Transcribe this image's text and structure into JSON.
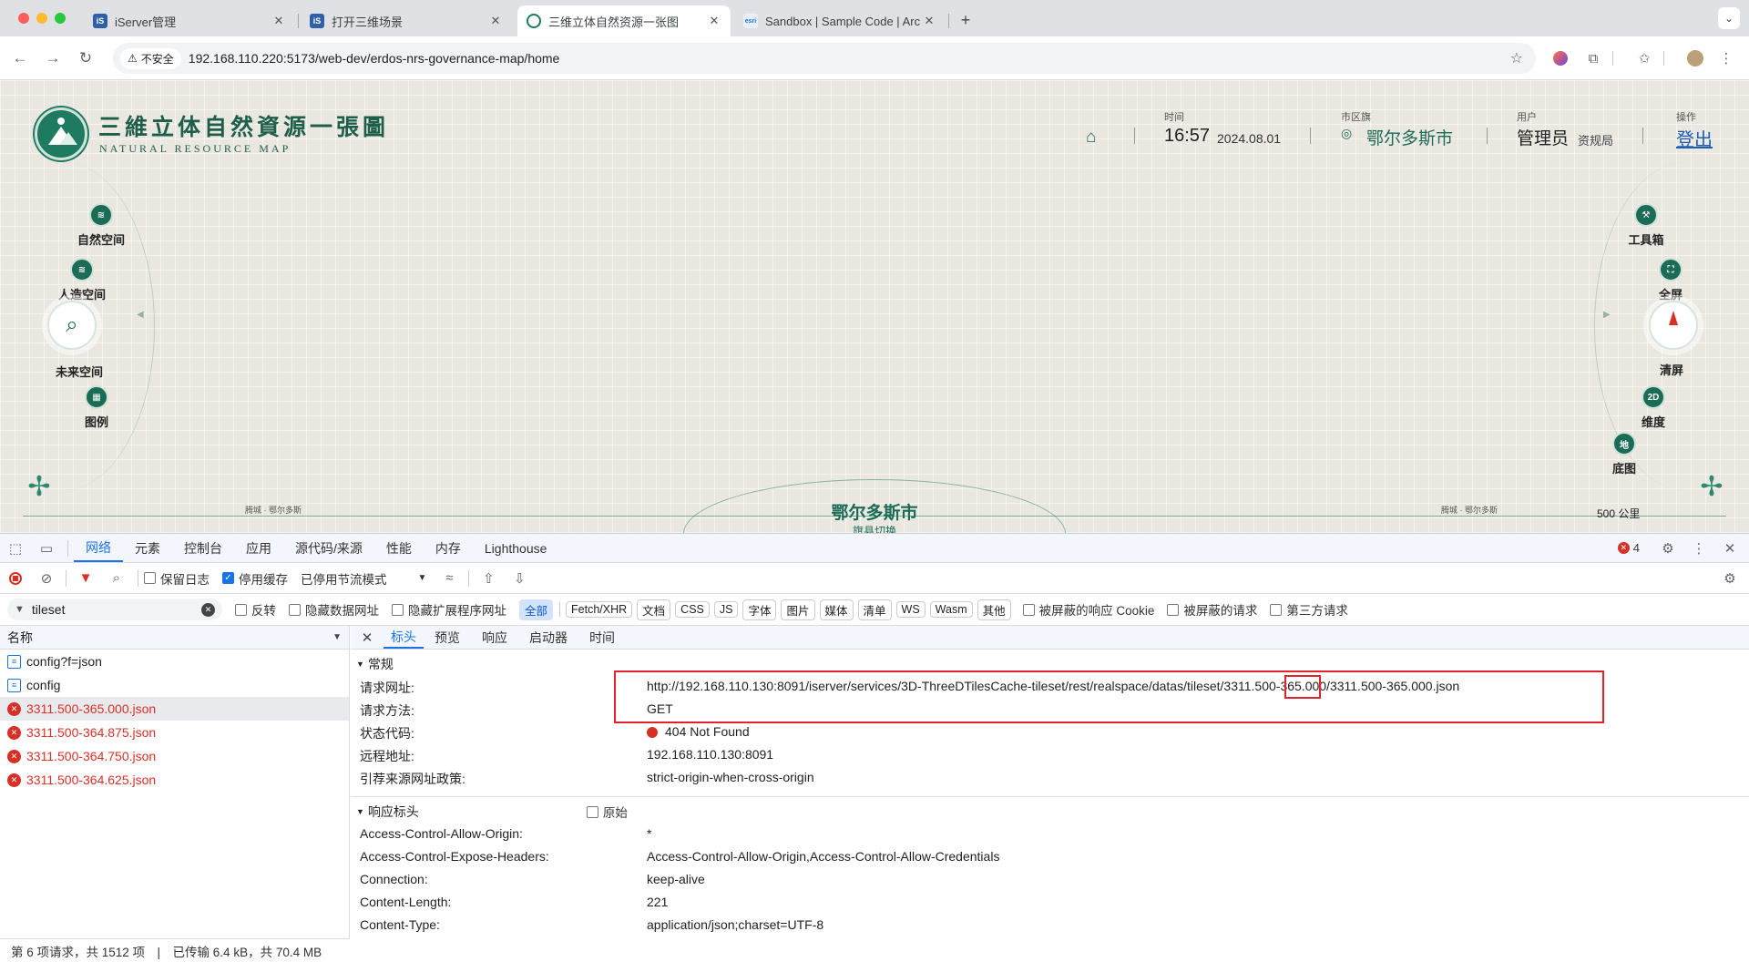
{
  "browser": {
    "tabs": [
      {
        "title": "iServer管理",
        "favicon": "iS"
      },
      {
        "title": "打开三维场景",
        "favicon": "iS"
      },
      {
        "title": "三维立体自然资源一张图",
        "favicon": "globe"
      },
      {
        "title": "Sandbox | Sample Code | Arc",
        "favicon": "esri"
      }
    ],
    "insecure_label": "不安全",
    "url": "192.168.110.220:5173/web-dev/erdos-nrs-governance-map/home"
  },
  "app": {
    "title": "三維立体自然資源一張圖",
    "subtitle": "NATURAL RESOURCE MAP",
    "time_label": "时间",
    "time": "16:57",
    "date": "2024.08.01",
    "region_label": "市区旗",
    "region": "鄂尔多斯市",
    "user_label": "用户",
    "user": "管理员",
    "user_org": "资规局",
    "action_label": "操作",
    "logout": "登出",
    "left_menu": [
      "自然空间",
      "人造空间",
      "未来空间",
      "图例"
    ],
    "right_menu": [
      "工具箱",
      "全屏",
      "清屏",
      "维度",
      "底图"
    ],
    "right_badges": {
      "dim": "2D",
      "base": "地"
    },
    "bottom_city": "鄂尔多斯市",
    "bottom_switch": "旗县切换",
    "bottom_left_note": "腾城 · 鄂尔多斯",
    "bottom_right_note": "腾城 · 鄂尔多斯",
    "scale": "500 公里"
  },
  "devtools": {
    "tabs": [
      "网络",
      "元素",
      "控制台",
      "应用",
      "源代码/来源",
      "性能",
      "内存",
      "Lighthouse"
    ],
    "error_count": "4",
    "toolbar": {
      "preserve_log": "保留日志",
      "disable_cache": "停用缓存",
      "throttle": "已停用节流模式"
    },
    "filter": {
      "value": "tileset",
      "invert": "反转",
      "hide_data": "隐藏数据网址",
      "hide_ext": "隐藏扩展程序网址",
      "types": [
        "全部",
        "Fetch/XHR",
        "文档",
        "CSS",
        "JS",
        "字体",
        "图片",
        "媒体",
        "清单",
        "WS",
        "Wasm",
        "其他"
      ],
      "blocked_cookies": "被屏蔽的响应 Cookie",
      "blocked_req": "被屏蔽的请求",
      "third_party": "第三方请求"
    },
    "list_header": "名称",
    "requests": [
      {
        "name": "config?f=json",
        "status": "ok"
      },
      {
        "name": "config",
        "status": "ok"
      },
      {
        "name": "3311.500-365.000.json",
        "status": "error"
      },
      {
        "name": "3311.500-364.875.json",
        "status": "error"
      },
      {
        "name": "3311.500-364.750.json",
        "status": "error"
      },
      {
        "name": "3311.500-364.625.json",
        "status": "error"
      }
    ],
    "detail_tabs": [
      "标头",
      "预览",
      "响应",
      "启动器",
      "时间"
    ],
    "general_title": "常规",
    "general": [
      {
        "k": "请求网址:",
        "v": "http://192.168.110.130:8091/iserver/services/3D-ThreeDTilesCache-tileset/rest/realspace/datas/tileset/3311.500-365.000/3311.500-365.000.json"
      },
      {
        "k": "请求方法:",
        "v": "GET"
      },
      {
        "k": "状态代码:",
        "v": "404 Not Found"
      },
      {
        "k": "远程地址:",
        "v": "192.168.110.130:8091"
      },
      {
        "k": "引荐来源网址政策:",
        "v": "strict-origin-when-cross-origin"
      }
    ],
    "response_title": "响应标头",
    "raw_label": "原始",
    "response": [
      {
        "k": "Access-Control-Allow-Origin:",
        "v": "*"
      },
      {
        "k": "Access-Control-Expose-Headers:",
        "v": "Access-Control-Allow-Origin,Access-Control-Allow-Credentials"
      },
      {
        "k": "Connection:",
        "v": "keep-alive"
      },
      {
        "k": "Content-Length:",
        "v": "221"
      },
      {
        "k": "Content-Type:",
        "v": "application/json;charset=UTF-8"
      }
    ],
    "status_text": "第 6 项请求，共 1512 项　|　已传输 6.4 kB，共 70.4 MB"
  }
}
